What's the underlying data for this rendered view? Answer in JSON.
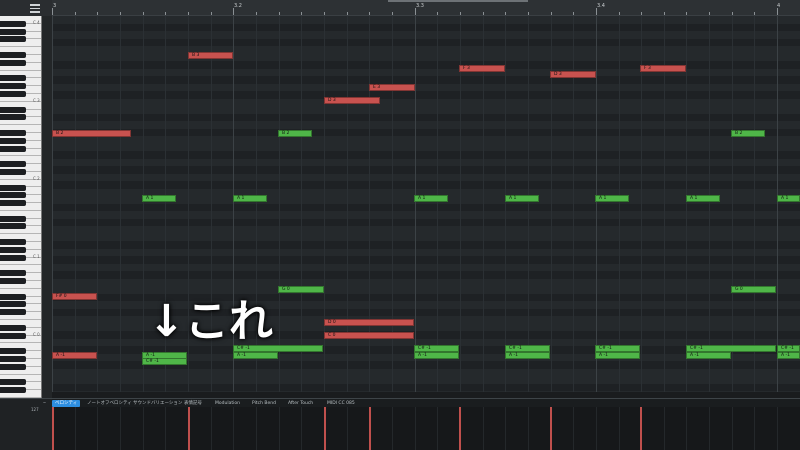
{
  "ruler": {
    "marks": [
      "3",
      "3.2",
      "3.3",
      "3.4",
      "4"
    ]
  },
  "keyboard": {
    "c_labels": [
      "C 4",
      "C 3",
      "C 2",
      "C 1",
      "C 0"
    ]
  },
  "notes": [
    {
      "label": "B 3",
      "color": "red"
    },
    {
      "label": "F 3",
      "color": "red"
    },
    {
      "label": "D 3",
      "color": "red"
    },
    {
      "label": "F 3",
      "color": "red"
    },
    {
      "label": "E 3",
      "color": "red"
    },
    {
      "label": "D 3",
      "color": "red"
    },
    {
      "label": "B 2",
      "color": "red"
    },
    {
      "label": "B 2",
      "color": "green"
    },
    {
      "label": "B 2",
      "color": "green"
    },
    {
      "label": "A 1",
      "color": "green"
    },
    {
      "label": "A 1",
      "color": "green"
    },
    {
      "label": "A 1",
      "color": "green"
    },
    {
      "label": "A 1",
      "color": "green"
    },
    {
      "label": "A 1",
      "color": "green"
    },
    {
      "label": "A 1",
      "color": "green"
    },
    {
      "label": "A 1",
      "color": "green"
    },
    {
      "label": "F# 0",
      "color": "red"
    },
    {
      "label": "G 0",
      "color": "green"
    },
    {
      "label": "G 0",
      "color": "green"
    },
    {
      "label": "D 0",
      "color": "red"
    },
    {
      "label": "C 0",
      "color": "red"
    },
    {
      "label": "A -1",
      "color": "red"
    },
    {
      "label": "A -1",
      "color": "green"
    },
    {
      "label": "C# -1",
      "color": "green"
    },
    {
      "label": "C# -1",
      "color": "green"
    },
    {
      "label": "A -1",
      "color": "green"
    },
    {
      "label": "C# -1",
      "color": "green"
    },
    {
      "label": "A -1",
      "color": "green"
    },
    {
      "label": "C# -1",
      "color": "green"
    },
    {
      "label": "A -1",
      "color": "green"
    },
    {
      "label": "C# -1",
      "color": "green"
    },
    {
      "label": "A -1",
      "color": "green"
    },
    {
      "label": "C# -1",
      "color": "green"
    },
    {
      "label": "A -1",
      "color": "green"
    },
    {
      "label": "C# -1",
      "color": "green"
    },
    {
      "label": "A -1",
      "color": "green"
    },
    {
      "label": "C# -1",
      "color": "green"
    },
    {
      "label": "A -1",
      "color": "green"
    }
  ],
  "annotation": "↓これ",
  "lane_tabs": [
    {
      "label": "ベロシティ",
      "active": true
    },
    {
      "label": "ノートオフベロシティ",
      "active": false
    },
    {
      "label": "サウンドバリエーション",
      "active": false
    },
    {
      "label": "表情記号",
      "active": false
    },
    {
      "label": "Modulation",
      "active": false
    },
    {
      "label": "Pitch Bend",
      "active": false
    },
    {
      "label": "After Touch",
      "active": false
    },
    {
      "label": "MIDI CC 085",
      "active": false
    }
  ],
  "lane": {
    "max_label": "127",
    "collapse_symbol": "–",
    "velocity_bar_count": 9
  },
  "colors": {
    "note_red": "#c8524f",
    "note_green": "#4fb648",
    "tab_active": "#2d8ee0",
    "velocity_stem": "#c0504d"
  }
}
